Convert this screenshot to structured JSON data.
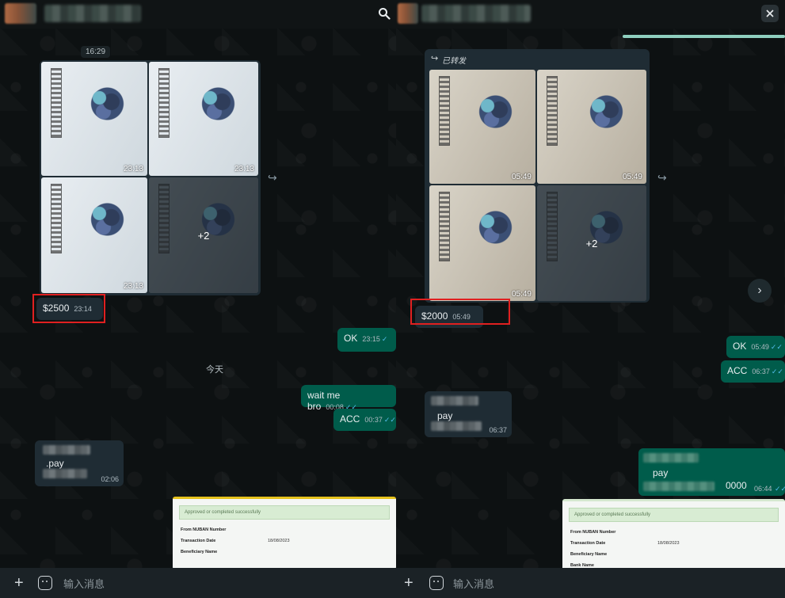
{
  "left": {
    "time_pill": "16:29",
    "album": {
      "photo_times": [
        "23:13",
        "23:13",
        "23:13"
      ],
      "more_count": "+2"
    },
    "amount_msg": {
      "text": "$2500",
      "time": "23:14"
    },
    "ok_msg": {
      "text": "OK",
      "time": "23:15"
    },
    "day_label": "今天",
    "wait_msg": {
      "text": "wait me bro",
      "time": "00:08"
    },
    "acc_msg": {
      "text": "ACC",
      "time": "00:37"
    },
    "pay_msg": {
      "text": ".pay",
      "time": "02:06"
    },
    "receipt": {
      "banner": "Approved or completed successfully",
      "rows": [
        {
          "k": "From NUBAN Number",
          "v": ""
        },
        {
          "k": "Transaction Date",
          "v": "18/08/2023"
        },
        {
          "k": "Beneficiary Name",
          "v": ""
        }
      ]
    },
    "composer": {
      "placeholder": "输入消息"
    }
  },
  "right": {
    "forwarded_label": "已转发",
    "album": {
      "photo_times": [
        "05:49",
        "05:49",
        "05:49"
      ],
      "more_count": "+2"
    },
    "amount_msg": {
      "text": "$2000",
      "time": "05:49"
    },
    "ok_msg": {
      "text": "OK",
      "time": "05:49"
    },
    "acc_msg": {
      "text": "ACC",
      "time": "06:37"
    },
    "pay_in_msg": {
      "text": "pay",
      "time": "06:37"
    },
    "pay_out_msg": {
      "text": "pay",
      "amount": "0000",
      "time": "06:44"
    },
    "receipt": {
      "banner": "Approved or completed successfully",
      "rows": [
        {
          "k": "From NUBAN Number",
          "v": ""
        },
        {
          "k": "Transaction Date",
          "v": "18/08/2023"
        },
        {
          "k": "Beneficiary Name",
          "v": ""
        },
        {
          "k": "Bank Name",
          "v": ""
        }
      ]
    },
    "composer": {
      "placeholder": "输入消息"
    }
  },
  "icons": {
    "search": "search-icon",
    "close": "close-icon",
    "forward": "forward-icon",
    "chevron": "chevron-right-icon",
    "plus": "plus-icon",
    "emoji": "sticker-icon"
  },
  "colors": {
    "outgoing": "#005c4b",
    "incoming": "#1f2c34",
    "highlight": "#e02020",
    "read_ticks": "#53bdeb"
  }
}
